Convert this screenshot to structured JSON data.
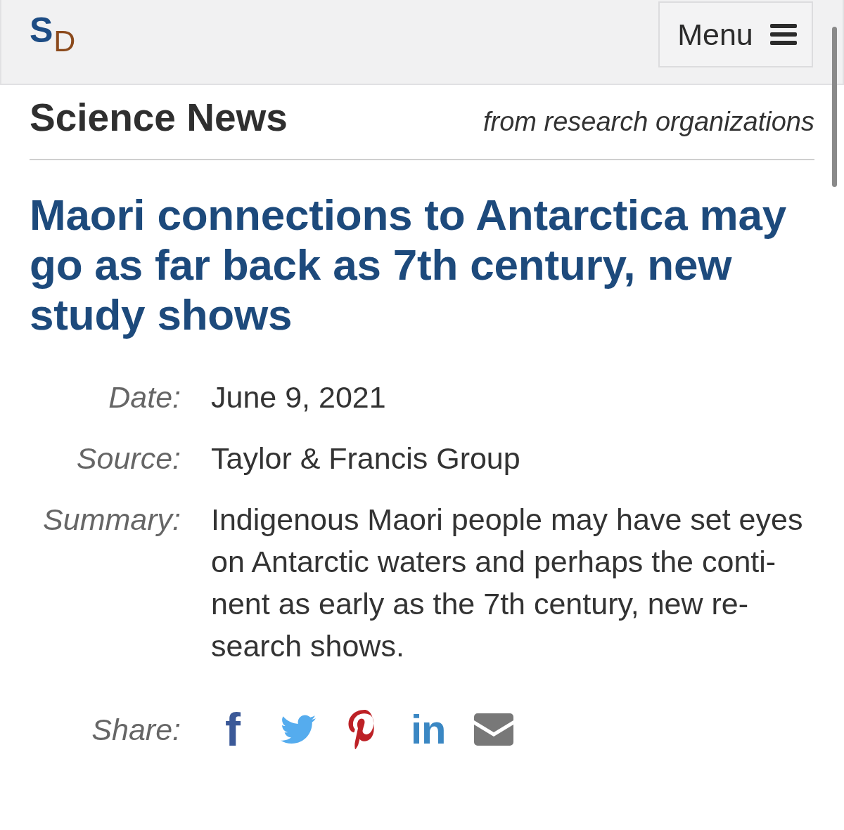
{
  "header": {
    "logo": {
      "letter_1": "S",
      "letter_2": "D"
    },
    "menu_button": {
      "label": "Menu"
    }
  },
  "section": {
    "title": "Science News",
    "tagline": "from research organizations"
  },
  "article": {
    "headline": "Maori connections to Antarctica may go as far back as 7th century, new study shows",
    "meta": [
      {
        "label": "Date:",
        "value": "June 9, 2021"
      },
      {
        "label": "Source:",
        "value": "Taylor & Francis Group"
      },
      {
        "label": "Summary:",
        "value": "Indigenous Maori people may have set eyes on Antarctic waters and perhaps the conti-nent as early as the 7th century, new re-search shows."
      }
    ],
    "share": {
      "label": "Share:",
      "buttons": [
        {
          "kind": "facebook",
          "glyph": "f"
        },
        {
          "kind": "twitter"
        },
        {
          "kind": "pinterest"
        },
        {
          "kind": "linkedin",
          "glyph": "in"
        },
        {
          "kind": "email"
        }
      ]
    }
  }
}
